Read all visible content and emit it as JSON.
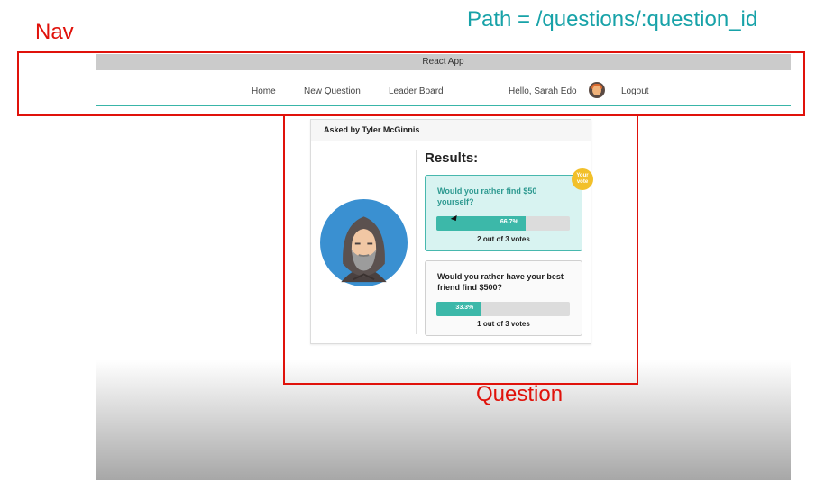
{
  "annotations": {
    "nav_label": "Nav",
    "path_label": "Path = /questions/:question_id",
    "question_label": "Question"
  },
  "app": {
    "title": "React App",
    "nav": {
      "home": "Home",
      "new_question": "New Question",
      "leader_board": "Leader Board",
      "greeting": "Hello, Sarah Edo",
      "logout": "Logout"
    }
  },
  "question": {
    "asked_by": "Asked by Tyler McGinnis",
    "results_title": "Results:",
    "options": [
      {
        "text": "Would you rather find $50 yourself?",
        "percent": 66.7,
        "percent_label": "66.7%",
        "votes_label": "2 out of 3 votes",
        "your_vote": true,
        "badge": "Your vote"
      },
      {
        "text": "Would you rather have your best friend find $500?",
        "percent": 33.3,
        "percent_label": "33.3%",
        "votes_label": "1 out of 3 votes",
        "your_vote": false
      }
    ]
  },
  "icons": {
    "user_avatar": "avatar-icon",
    "author_avatar": "hooded-man-avatar-icon",
    "cursor": "mouse-cursor-icon"
  },
  "colors": {
    "annotation_red": "#e0120b",
    "annotation_teal": "#17a2a8",
    "accent": "#3cb8a9",
    "badge": "#f2c02a"
  }
}
